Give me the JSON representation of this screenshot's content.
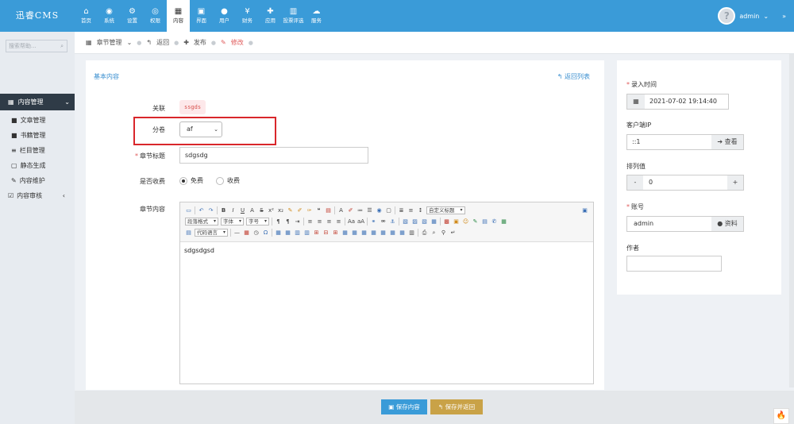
{
  "app": {
    "brand": "迅睿CMS"
  },
  "nav": [
    {
      "icon": "⌂",
      "label": "首页",
      "name": "home"
    },
    {
      "icon": "◉",
      "label": "系统",
      "name": "system"
    },
    {
      "icon": "⚙",
      "label": "设置",
      "name": "settings"
    },
    {
      "icon": "◎",
      "label": "权限",
      "name": "permission"
    },
    {
      "icon": "▦",
      "label": "内容",
      "name": "content",
      "active": true
    },
    {
      "icon": "▣",
      "label": "界面",
      "name": "interface"
    },
    {
      "icon": "●",
      "label": "用户",
      "name": "users"
    },
    {
      "icon": "¥",
      "label": "财务",
      "name": "finance"
    },
    {
      "icon": "✚",
      "label": "应用",
      "name": "apps"
    },
    {
      "icon": "▥",
      "label": "投票评选",
      "name": "vote"
    },
    {
      "icon": "☁",
      "label": "服务",
      "name": "service"
    }
  ],
  "user": {
    "name": "admin",
    "caret": "⌄",
    "dbl": "»"
  },
  "sidebar": {
    "search_placeholder": "搜索帮助...",
    "group": {
      "icon": "▦",
      "label": "内容管理"
    },
    "items": [
      {
        "icon": "■",
        "label": "文章管理",
        "name": "articles"
      },
      {
        "icon": "■",
        "label": "书籍管理",
        "name": "books"
      },
      {
        "icon": "≡",
        "label": "栏目管理",
        "name": "columns"
      },
      {
        "icon": "▢",
        "label": "静态生成",
        "name": "static-gen"
      },
      {
        "icon": "✎",
        "label": "内容维护",
        "name": "maintenance"
      }
    ],
    "audit": {
      "icon": "☑",
      "label": "内容审核",
      "chev": "‹"
    }
  },
  "breadcrumb": {
    "chapters": "章节管理",
    "back": "返回",
    "publish": "发布",
    "edit": "修改"
  },
  "form": {
    "section_title": "基本内容",
    "back_list": "返回列表",
    "related_label": "关联",
    "related_value": "ssgds",
    "volume_label": "分卷",
    "volume_value": "af",
    "title_label": "章节标题",
    "title_value": "sdgsdg",
    "charge_label": "是否收费",
    "charge_free": "免费",
    "charge_paid": "收费",
    "content_label": "章节内容",
    "content_value": "sdgsdgsd"
  },
  "editor": {
    "selects": {
      "custom_title": "自定义标题",
      "paragraph": "段落格式",
      "font": "字体",
      "size": "字号",
      "code_lang": "代码语言"
    }
  },
  "right": {
    "entry_time_label": "录入时间",
    "entry_time_value": "2021-07-02 19:14:40",
    "client_ip_label": "客户端IP",
    "client_ip_value": "::1",
    "view_btn": "查看",
    "sort_label": "排列值",
    "sort_value": "0",
    "minus": "-",
    "plus": "+",
    "account_label": "账号",
    "account_value": "admin",
    "profile_btn": "资料",
    "author_label": "作者",
    "author_value": ""
  },
  "footer": {
    "save": "保存内容",
    "save_back": "保存并返回"
  }
}
